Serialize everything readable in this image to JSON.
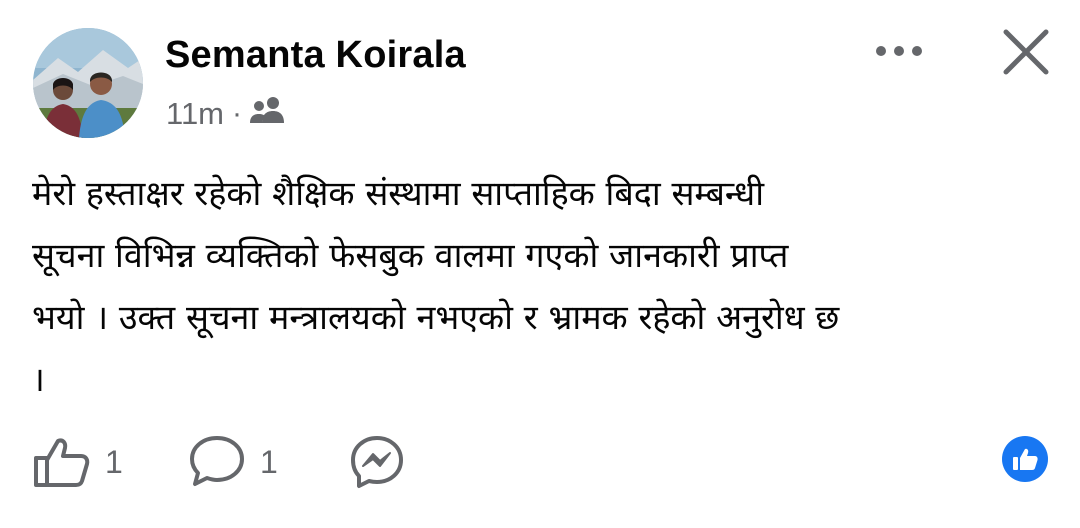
{
  "post": {
    "author_name": "Semanta Koirala",
    "time_ago": "11m",
    "separator": "·",
    "audience_icon": "friends-icon",
    "text": "मेरो हस्ताक्षर रहेको शैक्षिक संस्थामा साप्ताहिक बिदा सम्बन्धी\nसूचना विभिन्न व्यक्तिको फेसबुक वालमा गएको जानकारी प्राप्त\nभयो । उक्त सूचना मन्त्रालयको नभएको र भ्रामक रहेको अनुरोध छ\n।"
  },
  "actions": {
    "like_count": "1",
    "comment_count": "1",
    "like_icon": "thumbs-up-icon",
    "comment_icon": "comment-bubble-icon",
    "share_icon": "messenger-icon"
  },
  "header_icons": {
    "more": "more-options-icon",
    "close": "close-icon"
  },
  "colors": {
    "text": "#050505",
    "secondary": "#65676b",
    "accent": "#1877f2"
  }
}
